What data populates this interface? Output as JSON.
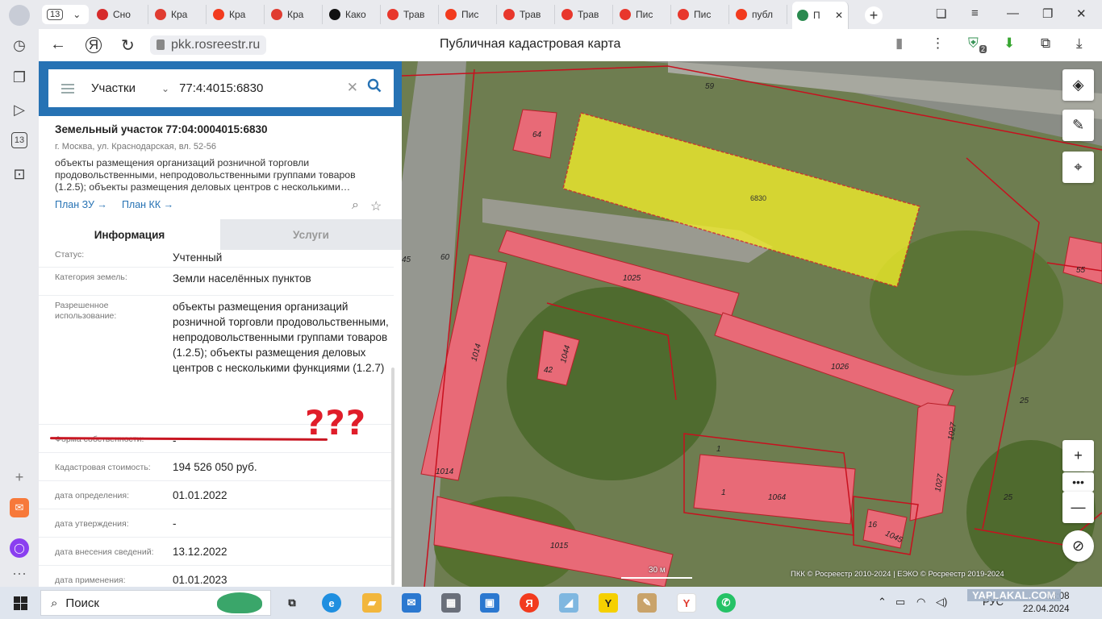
{
  "browser": {
    "tab_count": "13",
    "tabs": [
      {
        "label": "Сно",
        "color": "#d62b2b"
      },
      {
        "label": "Кра",
        "color": "#e03c31"
      },
      {
        "label": "Кра",
        "color": "#f23b1e"
      },
      {
        "label": "Кра",
        "color": "#e03c31"
      },
      {
        "label": "Како",
        "color": "#111111"
      },
      {
        "label": "Трав",
        "color": "#e8372c"
      },
      {
        "label": "Пис",
        "color": "#f23b1e"
      },
      {
        "label": "Трав",
        "color": "#e8372c"
      },
      {
        "label": "Трав",
        "color": "#e8372c"
      },
      {
        "label": "Пис",
        "color": "#e8372c"
      },
      {
        "label": "Пис",
        "color": "#e8372c"
      },
      {
        "label": "публ",
        "color": "#f23b1e"
      },
      {
        "label": "П",
        "color": "#2a8a4f"
      }
    ],
    "url": "pkk.rosreestr.ru",
    "page_title": "Публичная кадастровая карта",
    "extension_badge": "2"
  },
  "search": {
    "type_label": "Участки",
    "query": "77:4:4015:6830"
  },
  "object": {
    "title": "Земельный участок 77:04:0004015:6830",
    "address": "г. Москва, ул. Краснодарская, вл. 52-56",
    "description": "объекты размещения организаций розничной торговли продовольственными, непродовольственными группами товаров (1.2.5); объекты размещения деловых центров с несколькими…",
    "link_plan_zu": "План ЗУ →",
    "link_plan_kk": "План КК →"
  },
  "info_tabs": {
    "info": "Информация",
    "services": "Услуги"
  },
  "attributes": [
    {
      "label": "Статус:",
      "value": "Учтенный"
    },
    {
      "label": "Категория земель:",
      "value": "Земли населённых пунктов"
    },
    {
      "label": "Разрешенное использование:",
      "value": "объекты размещения организаций розничной торговли продовольственными, непродовольственными группами товаров (1.2.5); объекты размещения деловых центров с несколькими функциями (1.2.7)"
    },
    {
      "label": "Форма собственности:",
      "value": "-"
    },
    {
      "label": "Кадастровая стоимость:",
      "value": "194 526 050 руб."
    },
    {
      "label": "дата определения:",
      "value": "01.01.2022"
    },
    {
      "label": "дата утверждения:",
      "value": "-"
    },
    {
      "label": "дата внесения сведений:",
      "value": "13.12.2022"
    },
    {
      "label": "дата применения:",
      "value": "01.01.2023"
    }
  ],
  "annotation": "???",
  "map": {
    "highlight_color": "#f2ee2a",
    "building_color": "#e86a77",
    "labels": {
      "plot": "6830",
      "n59": "59",
      "n64": "64",
      "n60": "60",
      "n45": "45",
      "b1025": "1025",
      "b1014a": "1014",
      "b1014b": "1014",
      "b1044": "1044",
      "n42": "42",
      "b1026": "1026",
      "b1027a": "1027",
      "b1027b": "1027",
      "b1064": "1064",
      "n1a": "1",
      "n1b": "1",
      "n16": "16",
      "b1045": "1045",
      "b1015": "1015",
      "n55": "55",
      "n25a": "25",
      "n25b": "25"
    },
    "scale": "30 м",
    "copyright": "ПКК © Росреестр 2010-2024 | ЕЭКО © Росреестр 2019-2024"
  },
  "taskbar": {
    "search_label": "Поиск",
    "lang": "РУС",
    "time": "13:08",
    "date": "22.04.2024",
    "watermark": "YAPLAKAL.COM"
  }
}
